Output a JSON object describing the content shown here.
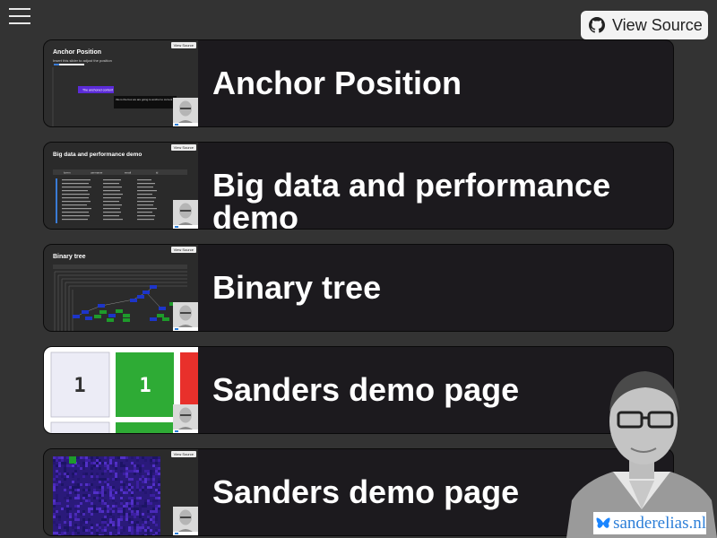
{
  "header": {
    "menu_icon": "hamburger-menu-icon",
    "view_source_label": "View Source",
    "view_source_icon": "github-icon"
  },
  "cards": [
    {
      "title": "Anchor Position",
      "thumb": {
        "title": "Anchor Position",
        "subtitle": "Insert this slider to adjust the position",
        "view_source": "View Source",
        "popup_label": "The anchored content",
        "tooltip": "this is the box we are going to anchor to current element. read read"
      }
    },
    {
      "title": "Big data and performance demo",
      "thumb": {
        "title": "Big data and performance demo",
        "view_source": "View Source",
        "columns": [
          "lorem",
          "username",
          "email",
          "id"
        ]
      }
    },
    {
      "title": "Binary tree",
      "thumb": {
        "title": "Binary tree",
        "view_source": "View Source"
      }
    },
    {
      "title": "Sanders demo page",
      "thumb": {
        "cells": [
          "1",
          "1"
        ]
      }
    },
    {
      "title": "Sanders demo page",
      "thumb": {
        "view_source": "View Source"
      }
    }
  ],
  "branding": {
    "site": "sanderelias.nl",
    "icon": "butterfly-icon"
  },
  "colors": {
    "background": "#333333",
    "card": "#1c1a1e",
    "brand_blue": "#2d7fd8",
    "green": "#2eab35",
    "red": "#e8302b"
  }
}
